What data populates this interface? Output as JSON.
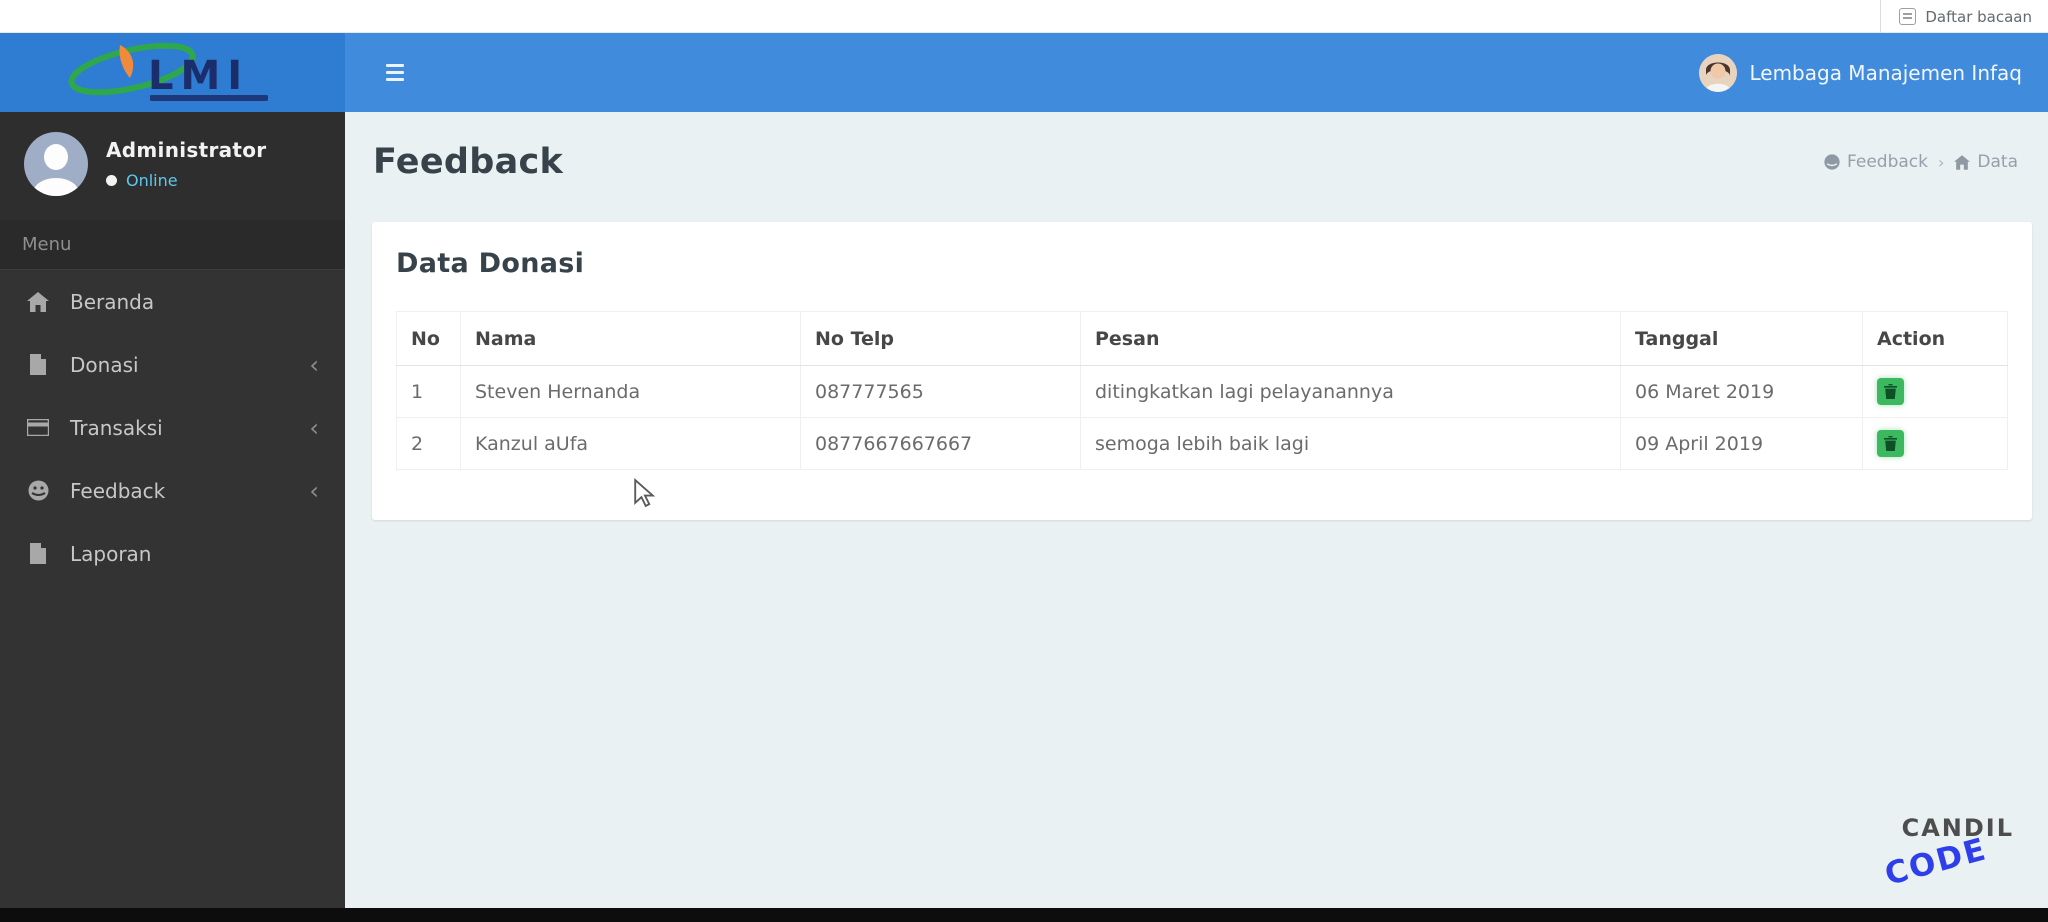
{
  "browser": {
    "reading_list": "Daftar bacaan"
  },
  "navbar": {
    "brand": {
      "text": "LMI"
    },
    "user": {
      "name": "Lembaga Manajemen Infaq"
    }
  },
  "sidebar": {
    "user": {
      "name": "Administrator",
      "status": "Online"
    },
    "menu_header": "Menu",
    "items": [
      {
        "label": "Beranda",
        "icon": "home-icon",
        "has_submenu": false
      },
      {
        "label": "Donasi",
        "icon": "file-icon",
        "has_submenu": true
      },
      {
        "label": "Transaksi",
        "icon": "card-icon",
        "has_submenu": true
      },
      {
        "label": "Feedback",
        "icon": "feedback-icon",
        "has_submenu": true
      },
      {
        "label": "Laporan",
        "icon": "file-icon",
        "has_submenu": false
      }
    ]
  },
  "page": {
    "title": "Feedback",
    "breadcrumb": [
      {
        "label": "Feedback",
        "icon": "feedback-icon"
      },
      {
        "label": "Data",
        "icon": "home-icon"
      }
    ]
  },
  "card": {
    "title": "Data Donasi",
    "table": {
      "headers": [
        "No",
        "Nama",
        "No Telp",
        "Pesan",
        "Tanggal",
        "Action"
      ],
      "rows": [
        {
          "no": "1",
          "nama": "Steven Hernanda",
          "no_telp": "087777565",
          "pesan": "ditingkatkan lagi pelayanannya",
          "tanggal": "06 Maret 2019",
          "action": "delete"
        },
        {
          "no": "2",
          "nama": "Kanzul aUfa",
          "no_telp": "0877667667667",
          "pesan": "semoga lebih baik lagi",
          "tanggal": "09 April 2019",
          "action": "delete"
        }
      ]
    }
  },
  "watermark": {
    "line1": "CANDIL",
    "line2": "CODE"
  },
  "icons": {
    "chevron_collapsed": "‹",
    "breadcrumb_separator": "›"
  },
  "colors": {
    "navbar_blue": "#418bdc",
    "brand_blue": "#2f7cd3",
    "sidebar_dark": "#333333",
    "content_bg": "#e9f1f2",
    "action_green": "#3cb95f",
    "watermark_blue": "#2e3eea",
    "online_blue": "#5ec8ee",
    "logo_navy": "#1c2d6b",
    "logo_green": "#2ea84a",
    "logo_orange": "#f08a3c"
  }
}
